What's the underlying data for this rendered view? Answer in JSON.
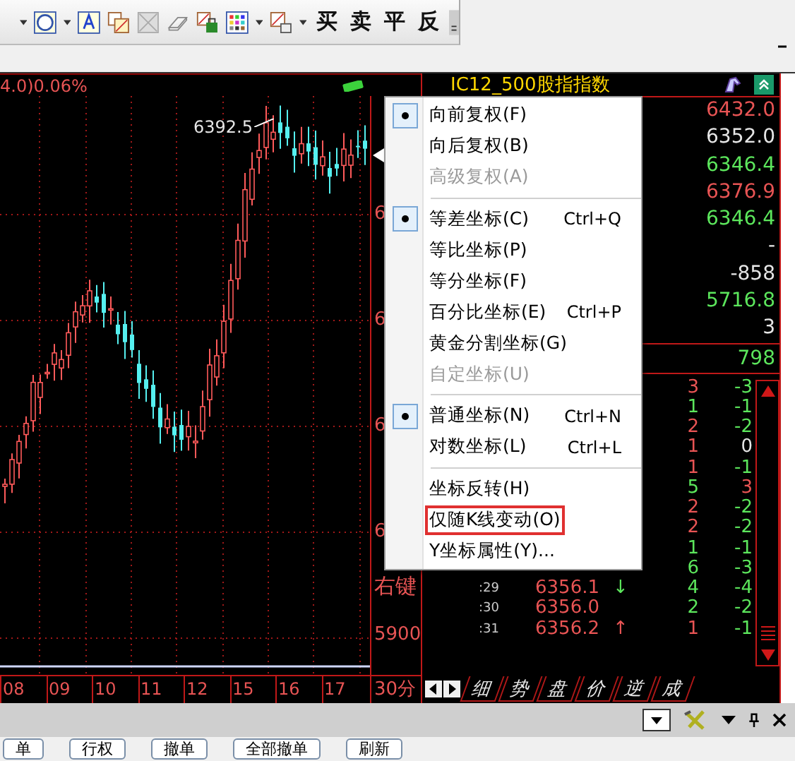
{
  "toolbar": {
    "trade_buttons": [
      "买",
      "卖",
      "平",
      "反"
    ]
  },
  "chart": {
    "header": "4.0)0.06%",
    "peak_label": "6392.5",
    "axis_labels": [
      "6",
      "6",
      "6",
      "6",
      "右键",
      "5900"
    ],
    "time_labels": [
      "08",
      "09",
      "10",
      "11",
      "12",
      "15",
      "16",
      "17"
    ],
    "period": "30分"
  },
  "quote": {
    "title": "IC12_500股指指数",
    "values": [
      {
        "text": "6432.0",
        "color": "#e85454"
      },
      {
        "text": "6352.0",
        "color": "#e6e6e6"
      },
      {
        "text": "6346.4",
        "color": "#5ce65c"
      },
      {
        "text": "6376.9",
        "color": "#e85454"
      },
      {
        "text": "6346.4",
        "color": "#5ce65c"
      },
      {
        "text": "-",
        "color": "#e6e6e6"
      },
      {
        "text": "-858",
        "color": "#e6e6e6"
      },
      {
        "text": "5716.8",
        "color": "#5ce65c"
      },
      {
        "text": "3",
        "color": "#e6e6e6"
      }
    ],
    "total": "798"
  },
  "trades": [
    {
      "volume": {
        "text": "3",
        "color": "#e85454"
      },
      "change": {
        "text": "-3",
        "color": "#5ce65c"
      }
    },
    {
      "volume": {
        "text": "1",
        "color": "#5ce65c"
      },
      "change": {
        "text": "-1",
        "color": "#5ce65c"
      }
    },
    {
      "volume": {
        "text": "2",
        "color": "#e85454"
      },
      "change": {
        "text": "-2",
        "color": "#5ce65c"
      }
    },
    {
      "volume": {
        "text": "1",
        "color": "#e85454"
      },
      "change": {
        "text": "0",
        "color": "#e6e6e6"
      }
    },
    {
      "volume": {
        "text": "1",
        "color": "#e85454"
      },
      "change": {
        "text": "-1",
        "color": "#5ce65c"
      }
    },
    {
      "volume": {
        "text": "5",
        "color": "#5ce65c"
      },
      "change": {
        "text": "3",
        "color": "#e85454"
      }
    },
    {
      "volume": {
        "text": "2",
        "color": "#e85454"
      },
      "change": {
        "text": "-2",
        "color": "#5ce65c"
      }
    },
    {
      "volume": {
        "text": "2",
        "color": "#e85454"
      },
      "change": {
        "text": "-2",
        "color": "#5ce65c"
      }
    },
    {
      "volume": {
        "text": "1",
        "color": "#5ce65c"
      },
      "change": {
        "text": "-1",
        "color": "#5ce65c"
      }
    },
    {
      "volume": {
        "text": "6",
        "color": "#5ce65c"
      },
      "change": {
        "text": "-3",
        "color": "#5ce65c"
      }
    },
    {
      "time": ":29",
      "price": "6356.1",
      "arrow": {
        "text": "↓",
        "color": "#5ce65c"
      },
      "volume": {
        "text": "4",
        "color": "#5ce65c"
      },
      "change": {
        "text": "-4",
        "color": "#5ce65c"
      }
    },
    {
      "time": ":30",
      "price": "6356.0",
      "volume": {
        "text": "2",
        "color": "#5ce65c"
      },
      "change": {
        "text": "-2",
        "color": "#5ce65c"
      }
    },
    {
      "time": ":31",
      "price": "6356.2",
      "arrow": {
        "text": "↑",
        "color": "#e85454"
      },
      "volume": {
        "text": "1",
        "color": "#e85454"
      },
      "change": {
        "text": "-1",
        "color": "#5ce65c"
      }
    }
  ],
  "tabs": [
    "细",
    "势",
    "盘",
    "价",
    "逆",
    "成"
  ],
  "menu": {
    "items": [
      {
        "kind": "item",
        "label": "向前复权(F)",
        "checked": true,
        "disabled": false,
        "highlighted": false
      },
      {
        "kind": "item",
        "label": "向后复权(B)",
        "checked": false,
        "disabled": false,
        "highlighted": false
      },
      {
        "kind": "item",
        "label": "高级复权(A)",
        "checked": false,
        "disabled": true,
        "highlighted": false
      },
      {
        "kind": "separator"
      },
      {
        "kind": "item",
        "label": "等差坐标(C)",
        "shortcut": "Ctrl+Q",
        "checked": true,
        "disabled": false,
        "highlighted": false
      },
      {
        "kind": "item",
        "label": "等比坐标(P)",
        "checked": false,
        "disabled": false,
        "highlighted": false
      },
      {
        "kind": "item",
        "label": "等分坐标(F)",
        "checked": false,
        "disabled": false,
        "highlighted": false
      },
      {
        "kind": "item",
        "label": "百分比坐标(E)",
        "shortcut": "Ctrl+P",
        "checked": false,
        "disabled": false,
        "highlighted": false
      },
      {
        "kind": "item",
        "label": "黄金分割坐标(G)",
        "checked": false,
        "disabled": false,
        "highlighted": false
      },
      {
        "kind": "item",
        "label": "自定坐标(U)",
        "checked": false,
        "disabled": true,
        "highlighted": false
      },
      {
        "kind": "separator"
      },
      {
        "kind": "item",
        "label": "普通坐标(N)",
        "shortcut": "Ctrl+N",
        "checked": true,
        "disabled": false,
        "highlighted": false
      },
      {
        "kind": "item",
        "label": "对数坐标(L)",
        "shortcut": "Ctrl+L",
        "checked": false,
        "disabled": false,
        "highlighted": false
      },
      {
        "kind": "separator"
      },
      {
        "kind": "item",
        "label": "坐标反转(H)",
        "checked": false,
        "disabled": false,
        "highlighted": false
      },
      {
        "kind": "item",
        "label": "仅随K线变动(O)",
        "checked": false,
        "disabled": false,
        "highlighted": true
      },
      {
        "kind": "item",
        "label": "Y坐标属性(Y)...",
        "checked": false,
        "disabled": false,
        "highlighted": false
      }
    ]
  },
  "bottom_buttons": [
    "单",
    "行权",
    "撤单",
    "全部撤单",
    "刷新"
  ]
}
